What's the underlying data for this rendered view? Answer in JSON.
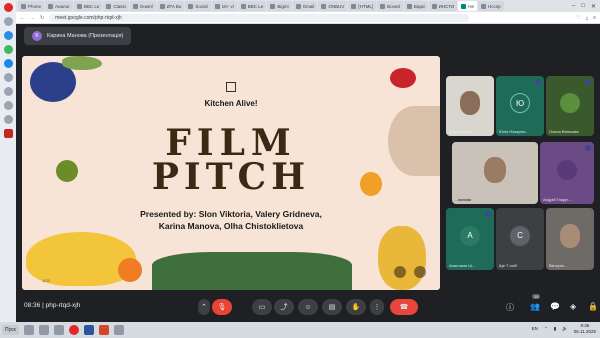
{
  "browser": {
    "tabs": [
      {
        "label": "Phone"
      },
      {
        "label": "Аналог"
      },
      {
        "label": "BBC Le"
      },
      {
        "label": "Classr"
      },
      {
        "label": "Downl"
      },
      {
        "label": "ZFA Bu"
      },
      {
        "label": "Social"
      },
      {
        "label": "15+ vi"
      },
      {
        "label": "BBC Le"
      },
      {
        "label": "Bigmi"
      },
      {
        "label": "Gmail"
      },
      {
        "label": "ONBUV"
      },
      {
        "label": "[HTML]"
      },
      {
        "label": "Boved"
      },
      {
        "label": "Відмі"
      },
      {
        "label": "ИНСТИ"
      },
      {
        "label": "Не"
      },
      {
        "label": "Нсспр"
      }
    ],
    "url": "meet.google.com/php-rtqd-xjh"
  },
  "meet": {
    "presenter_badge": "K",
    "presentation_title": "Карина Манова (Презентація)",
    "meeting_time": "08:36",
    "meeting_code": "php-rtqd-xjh",
    "participants_count": "15"
  },
  "slide": {
    "kitchen_title": "Kitchen Alive!",
    "film": "FILM",
    "pitch": "PITCH",
    "presenters_line1": "Presented by: Slon Viktoria, Valery Gridneva,",
    "presenters_line2": "Karina Manova, Olha Chistoklietova",
    "page": "1/23"
  },
  "participants": [
    {
      "name": "Карина Мано..."
    },
    {
      "name": "Юлія Назарен...",
      "initial": "Ю"
    },
    {
      "name": "Олеся Вітюкова"
    },
    {
      "name": "...ванова"
    },
    {
      "name": "Андрій Гладн..."
    },
    {
      "name": "Анастасія Ш...",
      "initial": "A"
    },
    {
      "name": "Ще 7 осіб",
      "initial": "C"
    },
    {
      "name": "Вікторія..."
    }
  ],
  "taskbar": {
    "start": "Пуск",
    "lang": "EN",
    "time": "8:36",
    "date": "06.11.2025"
  },
  "colors": {
    "meet_bg": "#1f2023",
    "slide_bg": "#f7e4d6",
    "end_call": "#ea4335"
  }
}
